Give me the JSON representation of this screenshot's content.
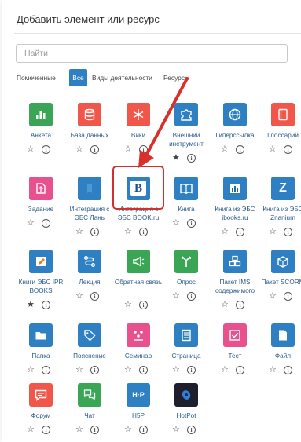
{
  "modal": {
    "title": "Добавить элемент или ресурс",
    "search_placeholder": "Найти"
  },
  "tabs": [
    {
      "label": "Помеченные",
      "active": false
    },
    {
      "label": "Все",
      "active": true
    },
    {
      "label": "Виды деятельности",
      "active": false
    },
    {
      "label": "Ресурсы",
      "active": false
    }
  ],
  "items": [
    {
      "label": "Анкета",
      "icon": "bar-chart-icon",
      "color": "#3aa655",
      "starred": false
    },
    {
      "label": "База данных",
      "icon": "database-icon",
      "color": "#f0574a",
      "starred": false
    },
    {
      "label": "Вики",
      "icon": "asterisk-icon",
      "color": "#f0574a",
      "starred": false
    },
    {
      "label": "Внешний инструмент",
      "icon": "puzzle-icon",
      "color": "#2f80c2",
      "starred": true
    },
    {
      "label": "Гиперссылка",
      "icon": "globe-icon",
      "color": "#2f80c2",
      "starred": false
    },
    {
      "label": "Глоссарий",
      "icon": "book-icon",
      "color": "#f0574a",
      "starred": false
    },
    {
      "label": "Задание",
      "icon": "upload-icon",
      "color": "#e8508e",
      "starred": false
    },
    {
      "label": "Интеграция с ЭБС Лань",
      "icon": "bookmark-icon",
      "color": "#2f80c2",
      "starred": false
    },
    {
      "label": "Интеграция с ЭБС BOOK.ru",
      "icon": "book-b-icon",
      "color": "#2f80c2",
      "starred": false
    },
    {
      "label": "Книга",
      "icon": "open-book-icon",
      "color": "#2f80c2",
      "starred": false
    },
    {
      "label": "Книга из ЭБС ibooks.ru",
      "icon": "chart-book-icon",
      "color": "#2f80c2",
      "starred": false
    },
    {
      "label": "Книга из ЭБС Znanium",
      "icon": "z-icon",
      "color": "#2f80c2",
      "starred": false
    },
    {
      "label": "Книги ЭБС IPR BOOKS",
      "icon": "pencil-icon",
      "color": "#2f80c2",
      "starred": true
    },
    {
      "label": "Лекция",
      "icon": "flow-icon",
      "color": "#2f80c2",
      "starred": false
    },
    {
      "label": "Обратная связь",
      "icon": "megaphone-icon",
      "color": "#3aa655",
      "starred": false
    },
    {
      "label": "Опрос",
      "icon": "fork-icon",
      "color": "#3aa655",
      "starred": false
    },
    {
      "label": "Пакет IMS содержимого",
      "icon": "boxes-icon",
      "color": "#2f80c2",
      "starred": false
    },
    {
      "label": "Пакет SCORM",
      "icon": "package-icon",
      "color": "#2f80c2",
      "starred": false
    },
    {
      "label": "Папка",
      "icon": "folder-icon",
      "color": "#2f80c2",
      "starred": false
    },
    {
      "label": "Пояснение",
      "icon": "tag-icon",
      "color": "#2f80c2",
      "starred": false
    },
    {
      "label": "Семинар",
      "icon": "group-icon",
      "color": "#e8508e",
      "starred": false
    },
    {
      "label": "Страница",
      "icon": "page-icon",
      "color": "#2f80c2",
      "starred": false
    },
    {
      "label": "Тест",
      "icon": "check-edit-icon",
      "color": "#e8508e",
      "starred": false
    },
    {
      "label": "Файл",
      "icon": "file-icon",
      "color": "#2f80c2",
      "starred": false
    },
    {
      "label": "Форум",
      "icon": "chat-lines-icon",
      "color": "#f0574a",
      "starred": false
    },
    {
      "label": "Чат",
      "icon": "chat-bubbles-icon",
      "color": "#3aa655",
      "starred": false
    },
    {
      "label": "H5P",
      "icon": "h5p-icon",
      "color": "#2f80c2",
      "starred": false
    },
    {
      "label": "HotPot",
      "icon": "hotpot-icon",
      "color": "#1e1e2e",
      "starred": false
    }
  ],
  "icon_glyphs": {
    "star_empty": "☆",
    "star_filled": "★",
    "info": "i",
    "book_b": "B",
    "z": "Z",
    "h5p": "H·P"
  }
}
